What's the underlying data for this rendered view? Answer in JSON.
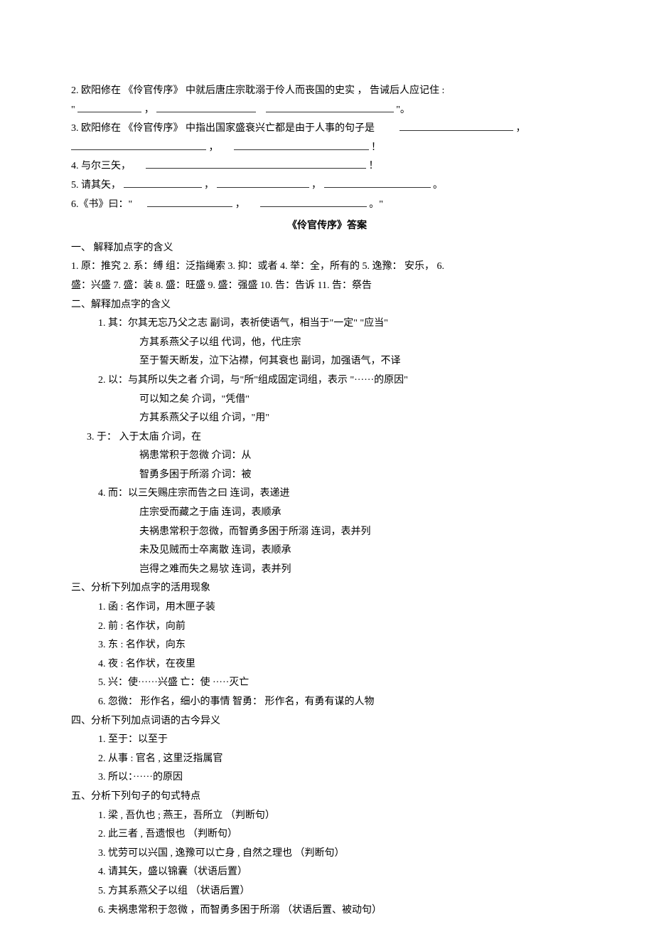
{
  "q2": "2. 欧阳修在 《伶官传序》 中就后唐庄宗耽溺于伶人而丧国的史实 ， 告诫后人应记住 :",
  "q2_quote_open": "\"",
  "q2_quote_close": "\"。",
  "comma": "，",
  "q3": "3. 欧阳修在 《伶官传序》 中指出国家盛衰兴亡都是由于人事的句子是",
  "q3_end": "！",
  "q4": "4. 与尔三矢，",
  "q4_end": "！",
  "q5": "5. 请其矢，",
  "q5_end": "。",
  "q6_prefix": "6.《书》曰：\"",
  "q6_close": "。\"",
  "answers_heading": "《伶官传序》答案",
  "sec1_title": "一、 解释加点字的含义",
  "sec1_line1": "1. 原：推究  2. 系：缚  组：泛指绳索  3. 抑：或者 4. 举：全，所有的   5. 逸豫： 安乐， 6.",
  "sec1_line2": "盛：兴盛  7. 盛：装  8. 盛：旺盛  9. 盛：强盛  10. 告：告诉  11. 告：祭告",
  "sec2_title": "二、解释加点字的含义",
  "sec2_1a": "1. 其：尔其无忘乃父之志      副词，表祈使语气，相当于\"一定\"  \"应当\"",
  "sec2_1b": "方其系燕父子以组      代词，他，代庄宗",
  "sec2_1c": "至于誓天断发，泣下沾襟，何其衰也      副词，加强语气，不译",
  "sec2_2a": "2. 以：与其所以失之者      介词，与\"所\"组成固定词组，表示   \"······的原因\"",
  "sec2_2b": "可以知之矣         介词，\"凭借\"",
  "sec2_2c": "方其系燕父子以组    介词，\"用\"",
  "sec2_3a": "3.   于：  入于太庙      介词，在",
  "sec2_3b": "祸患常积于忽微     介词：从",
  "sec2_3c": "智勇多困于所溺     介词：被",
  "sec2_4a": "4. 而：以三矢赐庄宗而告之曰    连词，表递进",
  "sec2_4b": "庄宗受而藏之于庙        连词，表顺承",
  "sec2_4c": "夫祸患常积于忽微，而智勇多困于所溺      连词，表并列",
  "sec2_4d": "未及见贼而士卒离散    连词，表顺承",
  "sec2_4e": "岂得之难而失之易欤    连词，表并列",
  "sec3_title": "三、分析下列加点字的活用现象",
  "sec3_1": "1. 函 : 名作词，用木匣子装",
  "sec3_2": "2. 前 : 名作状，向前",
  "sec3_3": "3. 东 : 名作状，向东",
  "sec3_4": "4. 夜 : 名作状，在夜里",
  "sec3_5": "5. 兴：使······兴盛    亡：使 ·····灭亡",
  "sec3_6": "6. 忽微： 形作名，细小的事情    智勇： 形作名，有勇有谋的人物",
  "sec4_title": "四、分析下列加点词语的古今异义",
  "sec4_1": "1. 至于：以至于",
  "sec4_2": "2. 从事 : 官名 , 这里泛指属官",
  "sec4_3": "3. 所以：······的原因",
  "sec5_title": "五、分析下列句子的句式特点",
  "sec5_1": "1. 梁 , 吾仇也 ; 燕王，吾所立  （判断句）",
  "sec5_2": "2. 此三者 , 吾遗恨也  （判断句）",
  "sec5_3": "3. 忧劳可以兴国 , 逸豫可以亡身 , 自然之理也  （判断句）",
  "sec5_4": "4. 请其矢，盛以锦囊（状语后置）",
  "sec5_5": "5. 方其系燕父子以组   （状语后置）",
  "sec5_6": "6. 夫祸患常积于忽微  ，而智勇多困于所溺   （状语后置、被动句）"
}
